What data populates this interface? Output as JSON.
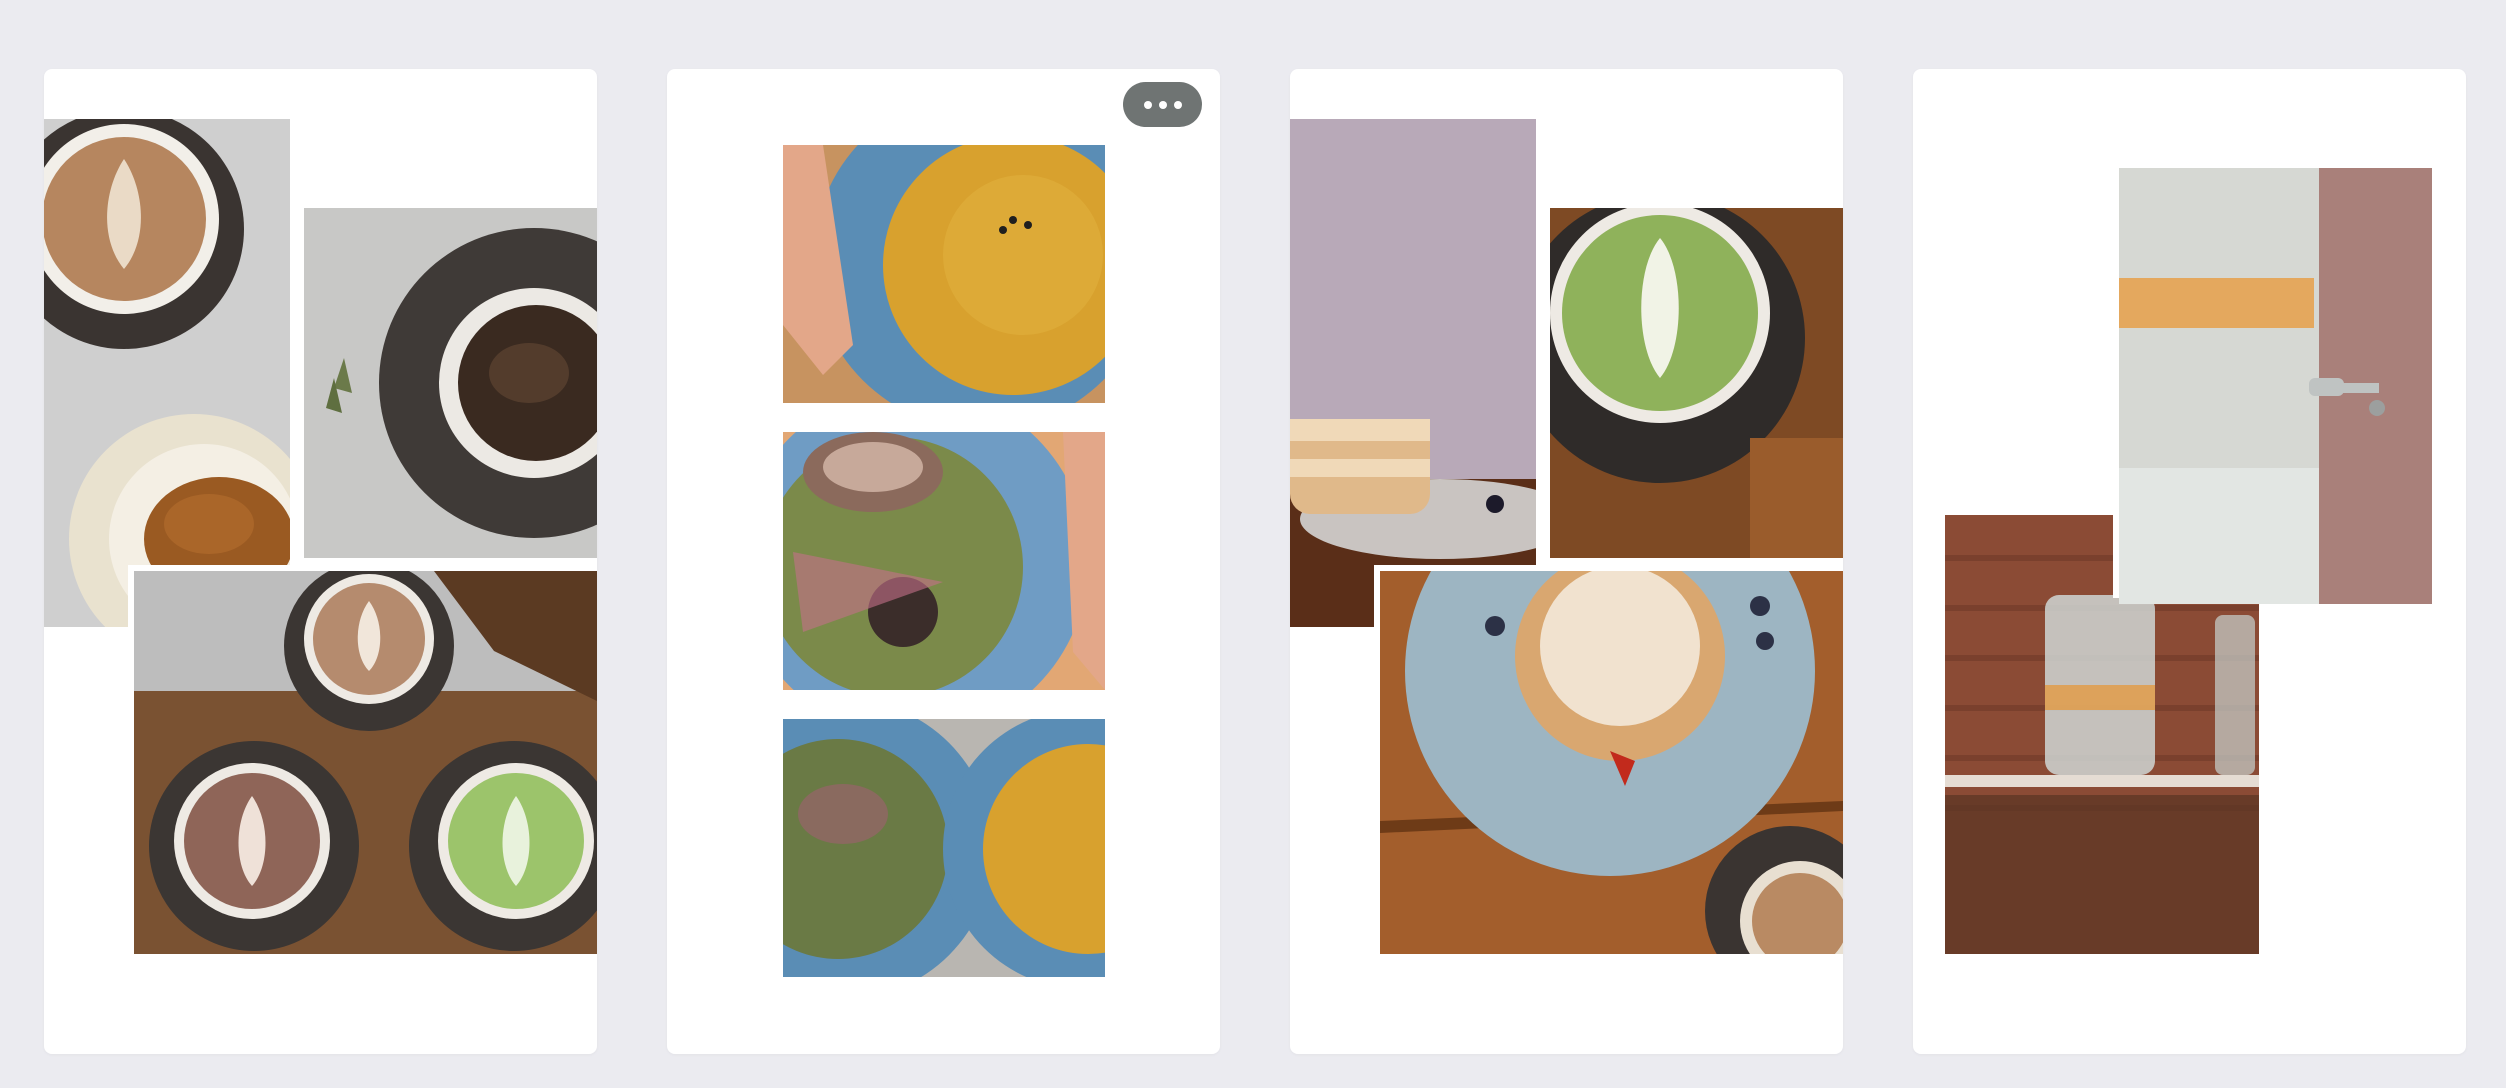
{
  "page": {
    "background": "#ebebf0",
    "card_color": "#ffffff"
  },
  "icons": {
    "more": "more-horizontal-icon"
  },
  "palette": {
    "coffee_crema": "#b98a63",
    "cup_dark": "#3b3633",
    "marble": "#d8d8d8",
    "matcha": "#8fb25b",
    "bowl_blue": "#5a8db5",
    "soup_yellow": "#d8a12e",
    "wood": "#a35e2c",
    "plate_blue": "#9db5c2",
    "brick": "#8b4b35"
  }
}
